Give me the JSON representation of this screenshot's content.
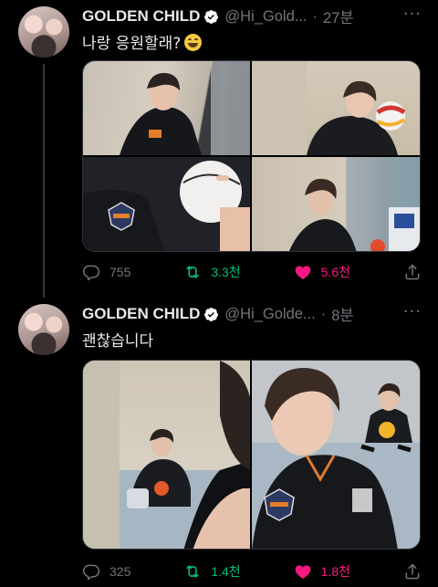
{
  "tweets": [
    {
      "name": "GOLDEN CHILD",
      "handle": "@Hi_Gold...",
      "dot": "·",
      "time": "27분",
      "more": "···",
      "text": "나랑 응원할래?",
      "replies": "755",
      "retweets": "3.3천",
      "likes": "5.6천"
    },
    {
      "name": "GOLDEN CHILD",
      "handle": "@Hi_Golde...",
      "dot": "·",
      "time": "8분",
      "more": "···",
      "text": "괜찮습니다",
      "replies": "325",
      "retweets": "1.4천",
      "likes": "1.8천"
    }
  ],
  "colors": {
    "background": "#000000",
    "retweet_active": "#00ba7c",
    "like_active": "#f91880",
    "verified": "#ffffff"
  },
  "icons": [
    "reply-icon",
    "retweet-icon",
    "like-icon",
    "share-icon",
    "verified-badge-icon",
    "more-icon"
  ]
}
